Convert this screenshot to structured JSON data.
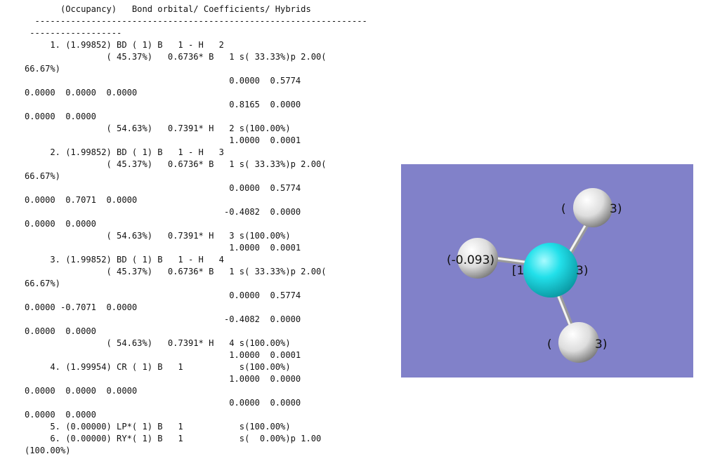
{
  "nbo_output": {
    "lines": [
      "       (Occupancy)   Bond orbital/ Coefficients/ Hybrids",
      "  -----------------------------------------------------------------",
      " ------------------",
      "     1. (1.99852) BD ( 1) B   1 - H   2",
      "                ( 45.37%)   0.6736* B   1 s( 33.33%)p 2.00(",
      "66.67%)",
      "                                        0.0000  0.5774",
      "0.0000  0.0000  0.0000",
      "                                        0.8165  0.0000",
      "0.0000  0.0000",
      "                ( 54.63%)   0.7391* H   2 s(100.00%)",
      "                                        1.0000  0.0001",
      "     2. (1.99852) BD ( 1) B   1 - H   3",
      "                ( 45.37%)   0.6736* B   1 s( 33.33%)p 2.00(",
      "66.67%)",
      "                                        0.0000  0.5774",
      "0.0000  0.7071  0.0000",
      "                                       -0.4082  0.0000",
      "0.0000  0.0000",
      "                ( 54.63%)   0.7391* H   3 s(100.00%)",
      "                                        1.0000  0.0001",
      "     3. (1.99852) BD ( 1) B   1 - H   4",
      "                ( 45.37%)   0.6736* B   1 s( 33.33%)p 2.00(",
      "66.67%)",
      "                                        0.0000  0.5774",
      "0.0000 -0.7071  0.0000",
      "                                       -0.4082  0.0000",
      "0.0000  0.0000",
      "                ( 54.63%)   0.7391* H   4 s(100.00%)",
      "                                        1.0000  0.0001",
      "     4. (1.99954) CR ( 1) B   1           s(100.00%)",
      "                                        1.0000  0.0000",
      "0.0000  0.0000  0.0000",
      "                                        0.0000  0.0000",
      "0.0000  0.0000",
      "     5. (0.00000) LP*( 1) B   1           s(100.00%)",
      "     6. (0.00000) RY*( 1) B   1           s(  0.00%)p 1.00",
      "(100.00%)"
    ]
  },
  "molecule_view": {
    "background_color": "#8181c9",
    "boron_color": "#22e0ea",
    "hydrogen_color": "#e6e6e6",
    "bond_color": "#d8d8d8",
    "labels": {
      "h_left": "(-0.093)",
      "h_top_left": "(",
      "h_top_right": "3)",
      "b_left": "[1",
      "b_right": "3)",
      "h_bottom_left": "(",
      "h_bottom_right": "3)"
    }
  }
}
